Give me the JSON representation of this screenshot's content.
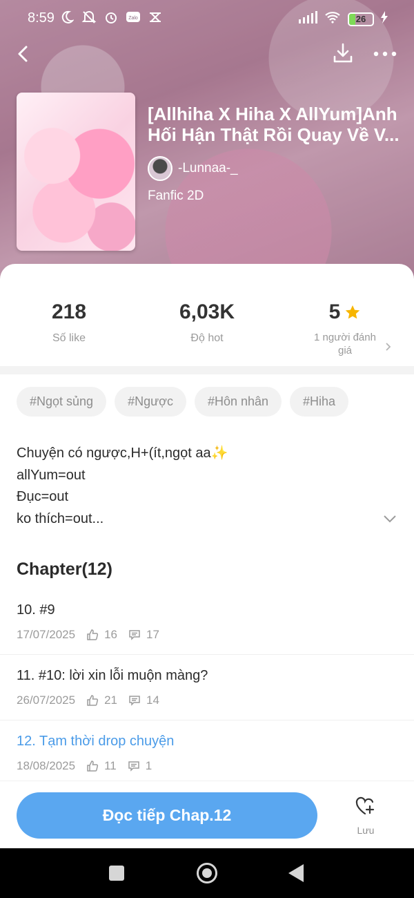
{
  "status_bar": {
    "time": "8:59",
    "battery": "26",
    "left_icons": [
      "moon-icon",
      "mute-icon",
      "alarm-icon",
      "zalo-icon",
      "capcut-icon"
    ],
    "right_icons": [
      "signal-icon",
      "wifi-icon",
      "battery-icon",
      "charging-icon"
    ]
  },
  "story": {
    "title": "[Allhiha X Hiha X AllYum]Anh Hối Hận Thật Rồi Quay Về V...",
    "author": "-Lunnaa-_",
    "genre": "Fanfic 2D"
  },
  "stats": {
    "likes_value": "218",
    "likes_label": "Số like",
    "hot_value": "6,03K",
    "hot_label": "Độ hot",
    "rating_value": "5",
    "rating_label": "1 người đánh giá"
  },
  "tags": [
    "#Ngọt sủng",
    "#Ngược",
    "#Hôn nhân",
    "#Hiha"
  ],
  "description": {
    "line1": "Chuyện có ngược,H+(ít,ngọt aa✨",
    "line2": "allYum=out",
    "line3": "Đục=out",
    "line4": "ko thích=out..."
  },
  "chapters": {
    "heading": "Chapter(12)",
    "items": [
      {
        "title": "10. #9",
        "date": "17/07/2025",
        "likes": "16",
        "comments": "17"
      },
      {
        "title": "11. #10: lời xin lỗi muộn màng?",
        "date": "26/07/2025",
        "likes": "21",
        "comments": "14"
      },
      {
        "title": "12. Tạm thời drop chuyện",
        "date": "18/08/2025",
        "likes": "11",
        "comments": "1"
      }
    ]
  },
  "actions": {
    "read_label": "Đọc tiếp Chap.12",
    "save_label": "Lưu"
  },
  "colors": {
    "accent": "#5aa7f0",
    "current_chapter": "#4a9be8",
    "star": "#f7b500"
  }
}
